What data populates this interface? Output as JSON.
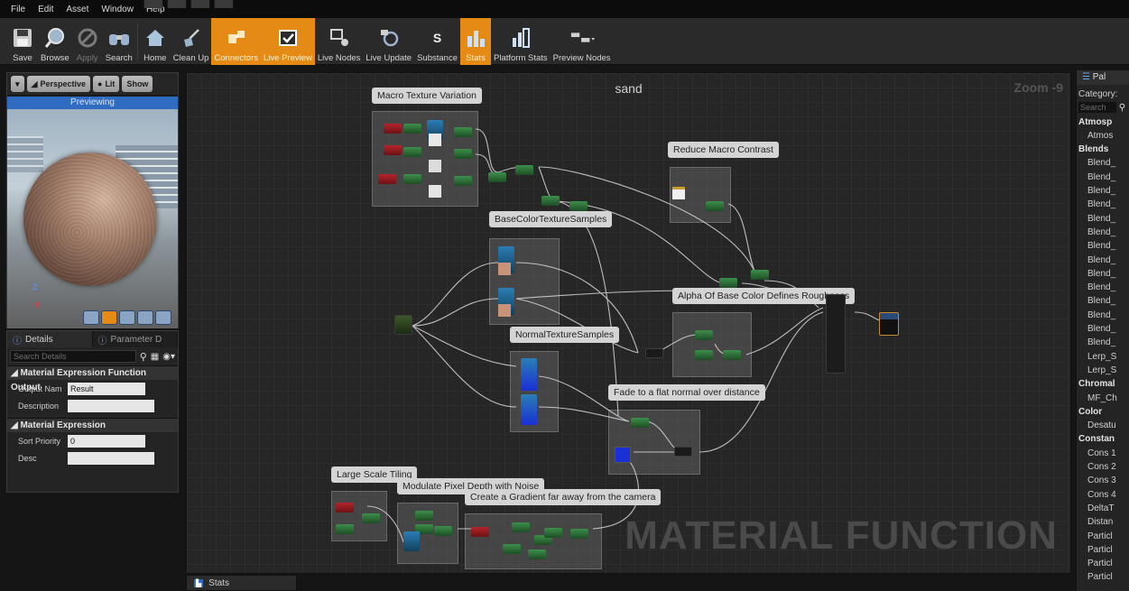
{
  "menubar": {
    "items": [
      "File",
      "Edit",
      "Asset",
      "Window",
      "Help"
    ]
  },
  "toolbar": {
    "buttons": [
      {
        "label": "Save",
        "icon": "floppy-disk-icon"
      },
      {
        "label": "Browse",
        "icon": "magnifier-icon"
      },
      {
        "label": "Apply",
        "icon": "apply-checkmark-icon"
      },
      {
        "label": "Search",
        "icon": "binoculars-icon"
      },
      {
        "label": "Home",
        "icon": "home-icon"
      },
      {
        "label": "Clean Up",
        "icon": "broom-icon"
      },
      {
        "label": "Connectors",
        "icon": "connectors-icon"
      },
      {
        "label": "Live Preview",
        "icon": "live-preview-checkbox-icon"
      },
      {
        "label": "Live Nodes",
        "icon": "live-nodes-icon"
      },
      {
        "label": "Live Update",
        "icon": "live-update-icon"
      },
      {
        "label": "Substance",
        "icon": "substance-icon"
      },
      {
        "label": "Stats",
        "icon": "stats-bars-icon"
      },
      {
        "label": "Platform Stats",
        "icon": "platform-stats-icon"
      },
      {
        "label": "Preview Nodes",
        "icon": "preview-nodes-icon"
      }
    ]
  },
  "viewport": {
    "perspective_label": "Perspective",
    "lit_label": "Lit",
    "show_label": "Show",
    "previewing_label": "Previewing",
    "axis_z": "Z",
    "axis_x": "X"
  },
  "details": {
    "tab_details": "Details",
    "tab_parameters": "Parameter D",
    "search_placeholder": "Search Details",
    "section_function_output": "Material Expression Function Output",
    "output_name_label": "Output Nam",
    "output_name_value": "Result",
    "description_label": "Description",
    "description_value": "",
    "section_expression": "Material Expression",
    "sort_priority_label": "Sort Priority",
    "sort_priority_value": "0",
    "desc_label": "Desc",
    "desc_value": ""
  },
  "graph": {
    "title": "sand",
    "zoom": "Zoom -9",
    "watermark": "MATERIAL FUNCTION",
    "comments": [
      "Macro Texture Variation",
      "Reduce Macro Contrast",
      "BaseColorTextureSamples",
      "Alpha Of Base Color Defines Roughness",
      "NormalTextureSamples",
      "Fade to a flat normal over distance",
      "Large Scale Tiling",
      "Modulate Pixel Depth with Noise",
      "Create a Gradient far away from the camera"
    ]
  },
  "stats_tab": {
    "label": "Stats"
  },
  "palette": {
    "tab_label": "Pal",
    "category_label": "Category:",
    "search_placeholder": "Search",
    "rows": [
      {
        "type": "cat",
        "text": "Atmosp"
      },
      {
        "type": "item",
        "text": "Atmos"
      },
      {
        "type": "cat",
        "text": "Blends"
      },
      {
        "type": "item",
        "text": "Blend_"
      },
      {
        "type": "item",
        "text": "Blend_"
      },
      {
        "type": "item",
        "text": "Blend_"
      },
      {
        "type": "item",
        "text": "Blend_"
      },
      {
        "type": "item",
        "text": "Blend_"
      },
      {
        "type": "item",
        "text": "Blend_"
      },
      {
        "type": "item",
        "text": "Blend_"
      },
      {
        "type": "item",
        "text": "Blend_"
      },
      {
        "type": "item",
        "text": "Blend_"
      },
      {
        "type": "item",
        "text": "Blend_"
      },
      {
        "type": "item",
        "text": "Blend_"
      },
      {
        "type": "item",
        "text": "Blend_"
      },
      {
        "type": "item",
        "text": "Blend_"
      },
      {
        "type": "item",
        "text": "Blend_"
      },
      {
        "type": "item",
        "text": "Lerp_S"
      },
      {
        "type": "item",
        "text": "Lerp_S"
      },
      {
        "type": "cat",
        "text": "Chromal"
      },
      {
        "type": "item",
        "text": "MF_Ch"
      },
      {
        "type": "cat",
        "text": "Color"
      },
      {
        "type": "item",
        "text": "Desatu"
      },
      {
        "type": "cat",
        "text": "Constan"
      },
      {
        "type": "item",
        "text": "Cons 1"
      },
      {
        "type": "item",
        "text": "Cons 2"
      },
      {
        "type": "item",
        "text": "Cons 3"
      },
      {
        "type": "item",
        "text": "Cons 4"
      },
      {
        "type": "item",
        "text": "DeltaT"
      },
      {
        "type": "item",
        "text": "Distan"
      },
      {
        "type": "item",
        "text": "Particl"
      },
      {
        "type": "item",
        "text": "Particl"
      },
      {
        "type": "item",
        "text": "Particl"
      },
      {
        "type": "item",
        "text": "Particl"
      }
    ]
  },
  "colors": {
    "accent": "#e58a14",
    "preview_blue": "#2e6bc1",
    "node_green": "#2f7a3b",
    "node_red": "#b5242a"
  }
}
